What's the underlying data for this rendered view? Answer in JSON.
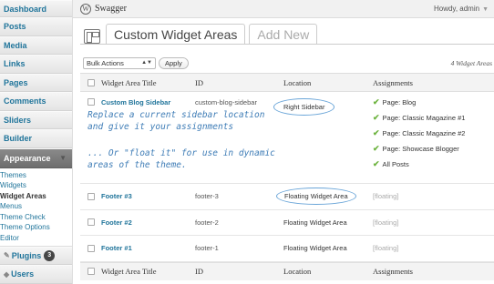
{
  "sidebar": {
    "items": [
      {
        "label": "Dashboard"
      },
      {
        "label": "Posts"
      },
      {
        "label": "Media"
      },
      {
        "label": "Links"
      },
      {
        "label": "Pages"
      },
      {
        "label": "Comments"
      },
      {
        "label": "Sliders"
      },
      {
        "label": "Builder"
      }
    ],
    "active": {
      "label": "Appearance"
    },
    "submenu": [
      "Themes",
      "Widgets",
      "Widget Areas",
      "Menus",
      "Theme Check",
      "Theme Options",
      "Editor"
    ],
    "plugins": {
      "label": "Plugins",
      "badge": "3"
    },
    "users": {
      "label": "Users"
    }
  },
  "header": {
    "site_title": "Swagger",
    "howdy": "Howdy, admin"
  },
  "tabs": [
    {
      "label": "Custom Widget Areas"
    },
    {
      "label": "Add New"
    }
  ],
  "bulk": {
    "select": "Bulk Actions",
    "apply": "Apply",
    "count": "4 Widget Areas"
  },
  "table": {
    "headers": [
      "Widget Area Title",
      "ID",
      "Location",
      "Assignments"
    ],
    "rows": [
      {
        "title": "Custom Blog Sidebar",
        "id": "custom-blog-sidebar",
        "location": "Right Sidebar",
        "assignments": [
          "Page: Blog",
          "Page: Classic Magazine #1",
          "Page: Classic Magazine #2",
          "Page: Showcase Blogger",
          "All Posts"
        ]
      },
      {
        "title": "Footer #3",
        "id": "footer-3",
        "location": "Floating Widget Area",
        "assignment": "[floating]"
      },
      {
        "title": "Footer #2",
        "id": "footer-2",
        "location": "Floating Widget Area",
        "assignment": "[floating]"
      },
      {
        "title": "Footer #1",
        "id": "footer-1",
        "location": "Floating Widget Area",
        "assignment": "[floating]"
      }
    ]
  },
  "annotations": {
    "line1": "Replace a current sidebar location",
    "line2": "and give it your assignments",
    "line3": "... Or \"float it\" for use in dynamic",
    "line4": "areas of the theme."
  },
  "colors": {
    "link": "#21759b",
    "annotation": "#3e7cb6",
    "check": "#6db33f",
    "active_menu": "#777777"
  }
}
